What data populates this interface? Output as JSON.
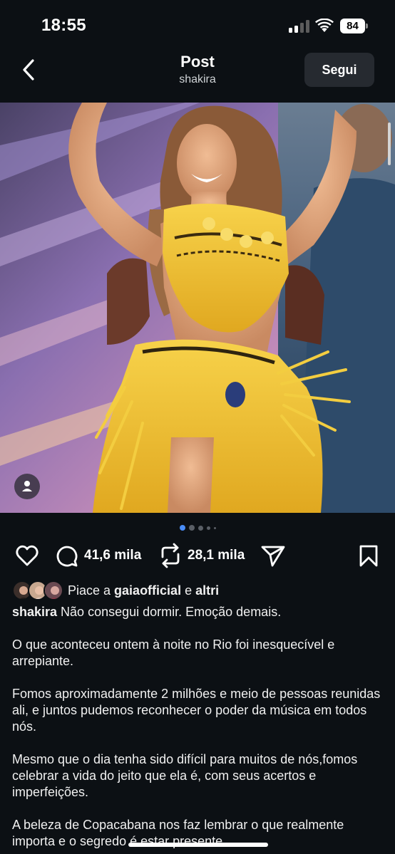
{
  "status_bar": {
    "time": "18:55",
    "battery": "84"
  },
  "header": {
    "title": "Post",
    "subtitle": "shakira",
    "follow_label": "Segui"
  },
  "carousel": {
    "slide_count": 5,
    "active_index": 0
  },
  "actions": {
    "comments_count": "41,6 mila",
    "reposts_count": "28,1 mila"
  },
  "likes": {
    "prefix": "Piace a ",
    "user": "gaiaofficial",
    "middle": " e ",
    "others": "altri"
  },
  "caption": {
    "username": "shakira",
    "first_line": " Não consegui dormir. Emoção demais.",
    "paragraphs": [
      "O que aconteceu ontem à noite no Rio foi inesquecível e arrepiante.",
      "Fomos aproximadamente 2 milhões e meio de pessoas reunidas ali, e juntos pudemos reconhecer o poder da música em todos nós.",
      "Mesmo que o dia tenha sido difícil para muitos de nós,fomos celebrar a vida do jeito que ela é, com seus acertos e imperfeições.",
      "A beleza de Copacabana nos faz lembrar o que realmente importa e o segredo é estar presente"
    ]
  },
  "colors": {
    "background": "#0c1014",
    "button_bg": "#262a30",
    "dot_active": "#4a8df8",
    "costume": "#f2c53a"
  }
}
